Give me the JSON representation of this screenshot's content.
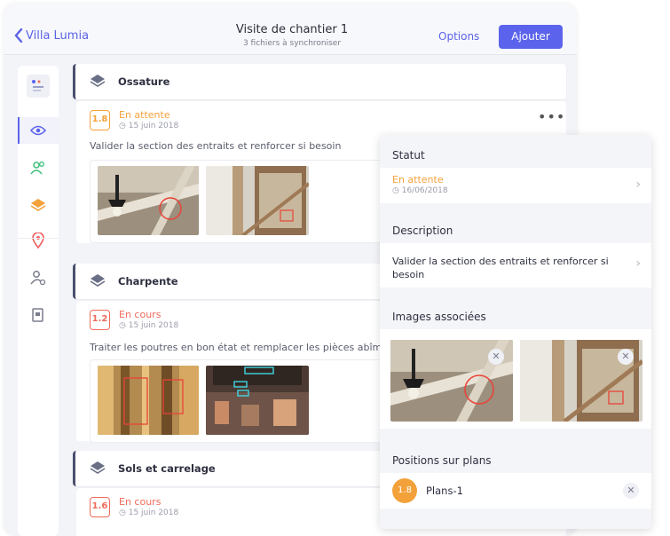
{
  "nav": {
    "back_label": "Villa Lumia",
    "title": "Visite de chantier 1",
    "subtitle": "3 fichiers à synchroniser",
    "options_label": "Options",
    "add_label": "Ajouter"
  },
  "sections": [
    {
      "title": "Ossature",
      "badge": "1.8",
      "status": "En attente",
      "status_color": "#f3a13a",
      "date": "15 juin 2018",
      "description": "Valider la section des entraits et renforcer si besoin"
    },
    {
      "title": "Charpente",
      "badge": "1.2",
      "status": "En cours",
      "status_color": "#ef6b5b",
      "date": "15 juin 2018",
      "description": "Traiter les poutres en bon état et remplacer les pièces abîmée"
    },
    {
      "title": "Sols et carrelage",
      "badge": "1.6",
      "status": "En cours",
      "status_color": "#ef6b5b",
      "date": "15 juin 2018"
    }
  ],
  "panel": {
    "statut_header": "Statut",
    "statut_value": "En attente",
    "statut_date": "16/06/2018",
    "description_header": "Description",
    "description_line1": "Valider la section des entraits et renforcer si",
    "description_line2": "besoin",
    "images_header": "Images associées",
    "positions_header": "Positions sur plans",
    "plan_badge": "1.8",
    "plan_label": "Plans-1"
  },
  "colors": {
    "accent": "#5b63ec",
    "pending": "#f3a13a",
    "in_progress": "#ef6b5b"
  }
}
